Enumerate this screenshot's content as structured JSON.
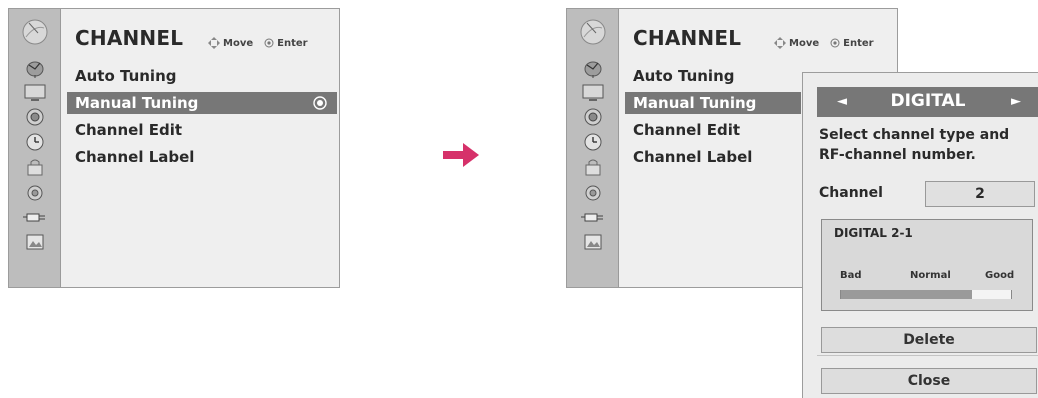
{
  "menu_before": {
    "title": "CHANNEL",
    "move_hint": "Move",
    "enter_hint": "Enter",
    "items": [
      {
        "label": "Auto Tuning"
      },
      {
        "label": "Manual Tuning",
        "selected": true
      },
      {
        "label": "Channel Edit"
      },
      {
        "label": "Channel Label"
      }
    ]
  },
  "menu_after": {
    "title": "CHANNEL",
    "move_hint": "Move",
    "enter_hint": "Enter",
    "items": [
      {
        "label": "Auto Tuning"
      },
      {
        "label": "Manual Tuning",
        "selected": true
      },
      {
        "label": "Channel Edit"
      },
      {
        "label": "Channel Label"
      }
    ]
  },
  "sidebar_icons": [
    "satellite-dish-icon",
    "tv-screen-icon",
    "speaker-icon",
    "clock-icon",
    "lock-icon",
    "option-icon",
    "input-plug-icon",
    "photo-icon"
  ],
  "popup": {
    "header_title": "DIGITAL",
    "left_arrow": "◄",
    "right_arrow": "►",
    "description": "Select channel type and RF-channel number.",
    "channel_label": "Channel",
    "channel_value": "2",
    "program_name": "DIGITAL 2-1",
    "signal_labels": {
      "bad": "Bad",
      "normal": "Normal",
      "good": "Good"
    },
    "signal_level": 0.77,
    "delete_label": "Delete",
    "close_label": "Close"
  },
  "colors": {
    "selection": "#777777",
    "arrow": "#d6316a",
    "menu_bg": "#efefef",
    "sidebar_bg": "#bdbdbd"
  }
}
